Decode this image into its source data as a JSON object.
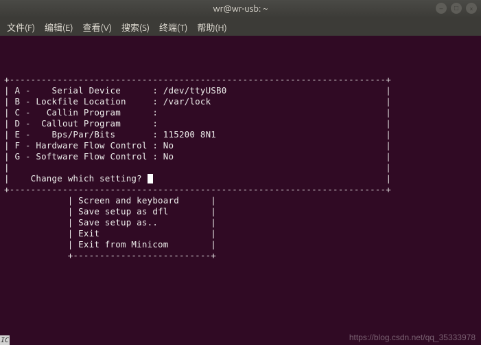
{
  "window": {
    "title": "wr@wr-usb: ~"
  },
  "menu": {
    "file": "文件(F)",
    "edit": "编辑(E)",
    "view": "查看(V)",
    "search": "搜索(S)",
    "terminal": "终端(T)",
    "help": "帮助(H)"
  },
  "config": {
    "border_top": "+-----------------------------------------------------------------------+",
    "rowA": "| A -    Serial Device      : /dev/ttyUSB0                              |",
    "rowB": "| B - Lockfile Location     : /var/lock                                 |",
    "rowC": "| C -   Callin Program      :                                           |",
    "rowD": "| D -  Callout Program      :                                           |",
    "rowE": "| E -    Bps/Par/Bits       : 115200 8N1                                |",
    "rowF": "| F - Hardware Flow Control : No                                        |",
    "rowG": "| G - Software Flow Control : No                                        |",
    "blank": "|                                                                       |",
    "prompt_pre": "|    Change which setting? ",
    "prompt_post": "                                            |",
    "border_bot": "+-----------------------------------------------------------------------+"
  },
  "submenu": {
    "item1": "            | Screen and keyboard      |",
    "item2": "            | Save setup as dfl        |",
    "item3": "            | Save setup as..          |",
    "item4": "            | Exit                     |",
    "item5": "            | Exit from Minicom        |",
    "border": "            +--------------------------+"
  },
  "watermark": "https://blog.csdn.net/qq_35333978",
  "corner": "IC"
}
